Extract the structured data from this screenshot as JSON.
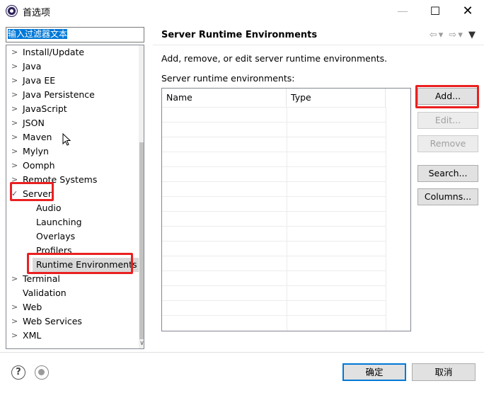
{
  "window": {
    "title": "首选项"
  },
  "filter": {
    "value": "输入过滤器文本"
  },
  "tree": {
    "items": [
      {
        "label": "Install/Update",
        "chevron": ">"
      },
      {
        "label": "Java",
        "chevron": ">"
      },
      {
        "label": "Java EE",
        "chevron": ">"
      },
      {
        "label": "Java Persistence",
        "chevron": ">"
      },
      {
        "label": "JavaScript",
        "chevron": ">"
      },
      {
        "label": "JSON",
        "chevron": ">"
      },
      {
        "label": "Maven",
        "chevron": ">"
      },
      {
        "label": "Mylyn",
        "chevron": ">"
      },
      {
        "label": "Oomph",
        "chevron": ">"
      },
      {
        "label": "Remote Systems",
        "chevron": ">"
      },
      {
        "label": "Server",
        "chevron": "✓"
      },
      {
        "label": "Audio",
        "chevron": ""
      },
      {
        "label": "Launching",
        "chevron": ""
      },
      {
        "label": "Overlays",
        "chevron": ""
      },
      {
        "label": "Profilers",
        "chevron": ""
      },
      {
        "label": "Runtime Environments",
        "chevron": ""
      },
      {
        "label": "Terminal",
        "chevron": ">"
      },
      {
        "label": "Validation",
        "chevron": ""
      },
      {
        "label": "Web",
        "chevron": ">"
      },
      {
        "label": "Web Services",
        "chevron": ">"
      },
      {
        "label": "XML",
        "chevron": ">"
      }
    ]
  },
  "page": {
    "title": "Server Runtime Environments",
    "description": "Add, remove, or edit server runtime environments.",
    "list_label": "Server runtime environments:",
    "columns": [
      "Name",
      "Type"
    ]
  },
  "buttons": {
    "add": "Add...",
    "edit": "Edit...",
    "remove": "Remove",
    "search": "Search...",
    "columns": "Columns..."
  },
  "dialog": {
    "ok": "确定",
    "cancel": "取消"
  },
  "icons": {
    "help": "?",
    "highlight_color": "#ea2020"
  }
}
